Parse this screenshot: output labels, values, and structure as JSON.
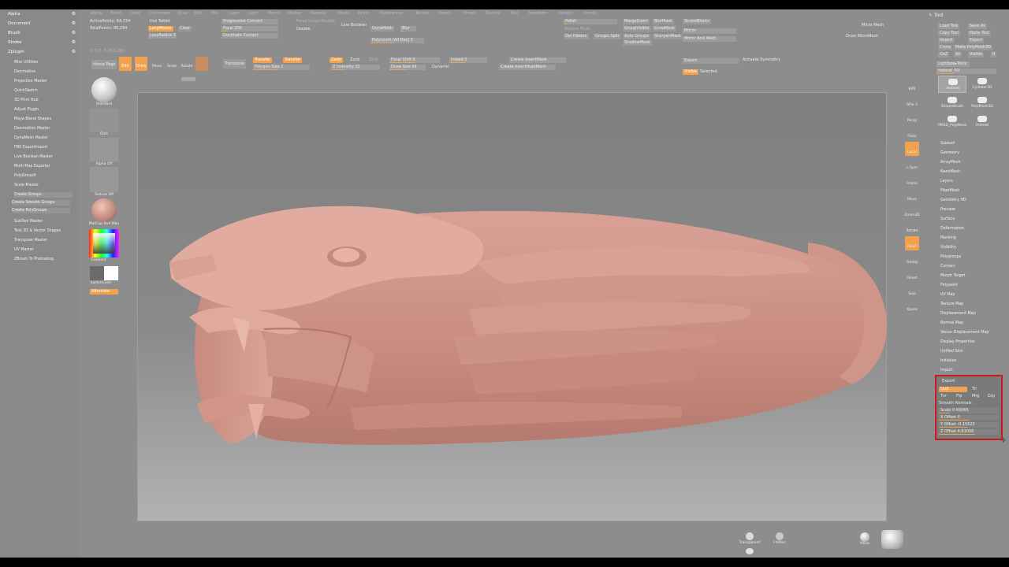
{
  "menubar": [
    "Alpha",
    "Brush",
    "Color",
    "Document",
    "Draw",
    "Edit",
    "File",
    "Layer",
    "Light",
    "Macro",
    "Marker",
    "Material",
    "Movie",
    "Picker",
    "Preferences",
    "Render",
    "Stencil",
    "Stroke",
    "Texture",
    "Tool",
    "Transform",
    "Zplugin",
    "Zscript"
  ],
  "left_panel": {
    "sections": [
      {
        "label": "Alpha",
        "icon": "⚙"
      },
      {
        "label": "Document",
        "icon": "⚙"
      },
      {
        "label": "Brush",
        "icon": "⚙"
      },
      {
        "label": "Stroke",
        "icon": "⚙"
      },
      {
        "label": "Zplugin",
        "icon": "⚙"
      }
    ],
    "plugins": [
      "Misc Utilities",
      "Decimation",
      "Projection Master",
      "QuickSketch",
      "3D Print Hub",
      "Adjust Plugin",
      "Maya Blend Shapes",
      "Decimation Master",
      "DynaMesh Master",
      "FBX ExportImport",
      "Live Boolean Master",
      "Multi Map Exporter",
      "PolyGroupIt",
      "Scale Master"
    ],
    "sub_plugins": [
      "Create Groups",
      "Create Smooth Groups",
      "Create PolyGroups"
    ],
    "plugins2": [
      "SubTool Master",
      "Text 3D & Vector Shapes",
      "Transpose Master",
      "UV Master",
      "ZBrush To Photoshop"
    ]
  },
  "top_shelf": {
    "stats": [
      "ActivePoints: 64,734",
      "TotalPoints: 80,294"
    ],
    "use_tablet": "Use Tablet",
    "lazymouse": "LazyMouse",
    "lazyradius": "LazyRadius 1",
    "clear": "Clear",
    "progressive": "Progressive Convert",
    "focal": "Focal 200",
    "decimate_current": "Decimate Current",
    "panel_loops": "Panel Loops Double",
    "double": "Double",
    "live_boolean": "Live Boolean",
    "dynamesh": "DynaMesh",
    "blur": "Blur",
    "polycount": "Polycount (All Dec) 5",
    "polish": "Polish",
    "reduce": "Reduce Mask",
    "del_hidden": "Del Hidden",
    "group_split": "Groups Split",
    "merge_down": "MergeDown",
    "group_visible": "GroupVisible",
    "auto_groups": "Auto Groups",
    "shadow_mask": "ShadowMask",
    "blur_mask": "BlurMask",
    "grow_mask": "GrowMask",
    "sharpen_mask": "SharpenMask",
    "stroke_blocks": "StrokeBlocks",
    "mirror": "Mirror",
    "mirror_weld": "Mirror And Weld",
    "micro_mesh": "Micro Mesh",
    "draw_micro": "Draw MicroMesh",
    "coords": "0.217, 0.16,0.281"
  },
  "second_shelf": {
    "home": "Home Page",
    "edit": "Edit",
    "draw": "Draw",
    "move": "Move",
    "scale": "Scale",
    "rotate": "Rotate",
    "transpose": "Transpose",
    "zadd": "Zadd",
    "zsub": "Zsub",
    "zcut": "Zcut",
    "rgb": "Transfer",
    "mrgb": "Transfer",
    "polygon_size": "Polygon Size 2",
    "z_intensity": "Z Intensity 25",
    "focal_shift": "Focal Shift 0",
    "draw_size": "Draw Size 64",
    "dynamic": "Dynamic",
    "imbed": "Imbed 0",
    "create_insert": "Create InsertMesh",
    "create_insert_multi": "Create InsertMultiMesh",
    "export": "Export",
    "visible": "Visible",
    "selected": "Selected",
    "activate_symmetry": "Activate Symmetry"
  },
  "brush_palette": {
    "standard": "Standard",
    "dots": "Dots",
    "alpha_off": "Alpha Off",
    "texture_off": "Texture Off",
    "matcap": "MatCap Red Wax",
    "gradient": "Gradient",
    "switch_color": "SwitchColor",
    "alternate": "Alternate"
  },
  "right_shelf": [
    "BPR",
    "SPix 3",
    "Persp",
    "Floor",
    "Local",
    "L.Sym",
    "Frame",
    "Move",
    "Zoom3D",
    "Rotate",
    "PolyF",
    "Transp",
    "Ghost",
    "Solo",
    "Xpose"
  ],
  "tool_panel": {
    "title": "Tool",
    "buttons": [
      "Load Tool",
      "Save As",
      "Copy Tool",
      "Paste Tool",
      "Import",
      "Export",
      "Clone",
      "Make PolyMesh3D",
      "GoZ",
      "All",
      "Visible",
      "R"
    ],
    "lightbox": "Lightbox▸Tools",
    "helmet": "Helmet_50",
    "thumbs": [
      "Helmet",
      "Cylinder3D",
      "SimpleBrush",
      "PolyMesh3D",
      "PM3D_PolyMesh",
      "Helmet"
    ],
    "sections": [
      "Subtool",
      "Geometry",
      "ArrayMesh",
      "NanoMesh",
      "Layers",
      "FiberMesh",
      "Geometry HD",
      "Preview",
      "Surface",
      "Deformation",
      "Masking",
      "Visibility",
      "Polygroups",
      "Contact",
      "Morph Target",
      "Polypaint",
      "UV Map",
      "Texture Map",
      "Displacement Map",
      "Normal Map",
      "Vector Displacement Map",
      "Display Properties",
      "Unified Skin",
      "Initialize",
      "Import"
    ],
    "export": {
      "title": "Export",
      "qud": "Qud",
      "tri": "Tri",
      "tex": "Txr",
      "flp": "Flp",
      "mrg": "Mrg",
      "grp": "Grp",
      "smooth_normals": "Smooth Normals",
      "scale": "Scale 0.40065",
      "x_offset": "X Offset 0",
      "y_offset": "Y Offset -0.15523",
      "z_offset": "Z Offset 4.81058"
    }
  },
  "bottom": {
    "transparent": "Transparent",
    "flatten": "Flatten",
    "move": "Move"
  },
  "colors": {
    "accent": "#f1a24e",
    "bg": "#8d8d8d",
    "model": "#e0a89b",
    "highlight": "#cc1e1e"
  }
}
